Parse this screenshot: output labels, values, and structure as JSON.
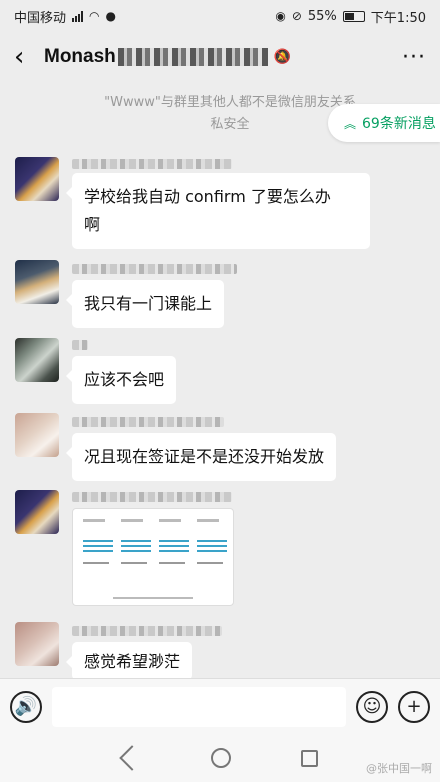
{
  "status_bar": {
    "carrier": "中国移动",
    "network": "4G",
    "battery": "55%",
    "time": "下午1:50"
  },
  "header": {
    "title": "Monash",
    "back_icon": "chevron-left-icon",
    "mute_icon": "bell-off-icon",
    "more_icon": "more-dots-icon"
  },
  "notice": {
    "line1": "\"Wwww\"与群里其他人都不是微信朋友关系",
    "line2": "私安全"
  },
  "new_messages": {
    "label": "69条新消息",
    "accent": "#07a062"
  },
  "messages": [
    {
      "text": "学校给我自动 confirm 了要怎么办\n啊"
    },
    {
      "text": "我只有一门课能上"
    },
    {
      "text": "应该不会吧"
    },
    {
      "text": "况且现在签证是不是还没开始发放"
    },
    {
      "text": ""
    },
    {
      "text": "感觉希望渺茫"
    }
  ],
  "image_message": {
    "caption": ""
  },
  "input_bar": {
    "voice_icon": "voice-icon",
    "emoji_icon": "emoji-icon",
    "add_icon": "plus-circle-icon"
  },
  "watermark": "@张中国一啊"
}
